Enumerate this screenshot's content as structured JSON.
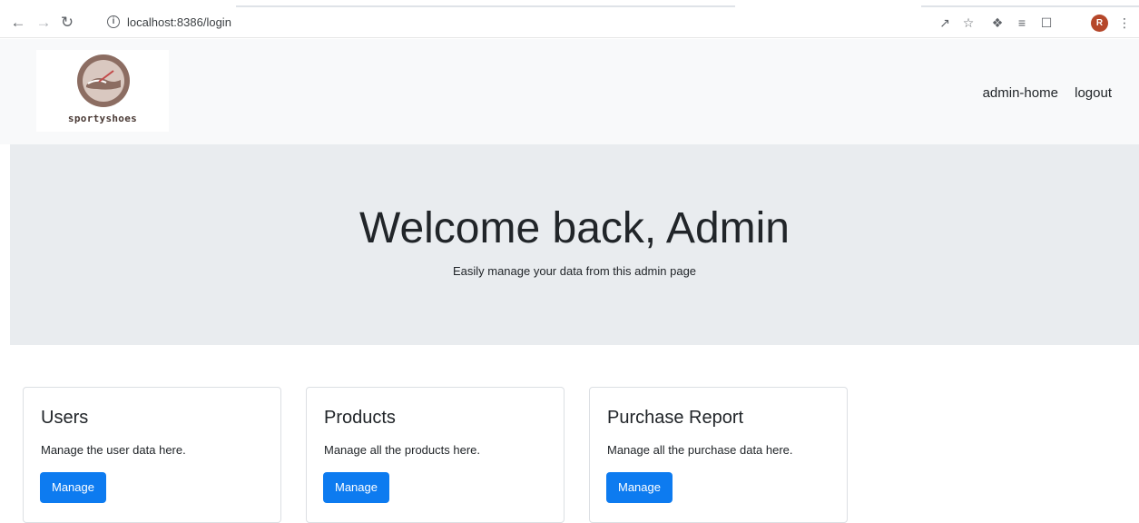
{
  "browser": {
    "url": "localhost:8386/login",
    "avatar_letter": "R"
  },
  "header": {
    "logo_text": "sportyshoes",
    "nav": [
      "admin-home",
      "logout"
    ]
  },
  "hero": {
    "title": "Welcome back, Admin",
    "subtitle": "Easily manage your data from this admin page"
  },
  "cards": [
    {
      "title": "Users",
      "text": "Manage the user data here.",
      "button": "Manage"
    },
    {
      "title": "Products",
      "text": "Manage all the products here.",
      "button": "Manage"
    },
    {
      "title": "Purchase Report",
      "text": "Manage all the purchase data here.",
      "button": "Manage"
    }
  ],
  "colors": {
    "primary_button": "#0d7bf0",
    "jumbotron_bg": "#e9ecef",
    "header_bg": "#f8f9fa"
  }
}
